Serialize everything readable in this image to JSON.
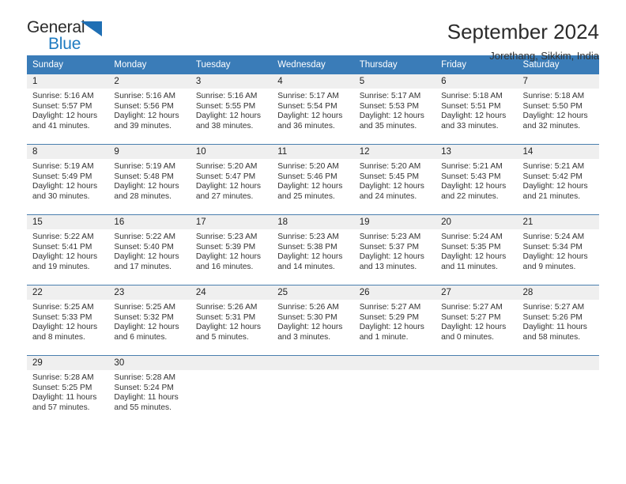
{
  "logo": {
    "word_one": "General",
    "word_two": "Blue",
    "triangle_icon": "triangle-icon",
    "accent_color": "#1f7bc1"
  },
  "header": {
    "title": "September 2024",
    "subtitle": "Jorethang, Sikkim, India"
  },
  "theme": {
    "header_blue": "#3a7cb8",
    "daynum_gray": "#efefef",
    "rule_color": "#4a7fae"
  },
  "weekdays": [
    "Sunday",
    "Monday",
    "Tuesday",
    "Wednesday",
    "Thursday",
    "Friday",
    "Saturday"
  ],
  "weeks": [
    [
      {
        "day": "1",
        "sunrise": "Sunrise: 5:16 AM",
        "sunset": "Sunset: 5:57 PM",
        "daylight_line1": "Daylight: 12 hours",
        "daylight_line2": "and 41 minutes."
      },
      {
        "day": "2",
        "sunrise": "Sunrise: 5:16 AM",
        "sunset": "Sunset: 5:56 PM",
        "daylight_line1": "Daylight: 12 hours",
        "daylight_line2": "and 39 minutes."
      },
      {
        "day": "3",
        "sunrise": "Sunrise: 5:16 AM",
        "sunset": "Sunset: 5:55 PM",
        "daylight_line1": "Daylight: 12 hours",
        "daylight_line2": "and 38 minutes."
      },
      {
        "day": "4",
        "sunrise": "Sunrise: 5:17 AM",
        "sunset": "Sunset: 5:54 PM",
        "daylight_line1": "Daylight: 12 hours",
        "daylight_line2": "and 36 minutes."
      },
      {
        "day": "5",
        "sunrise": "Sunrise: 5:17 AM",
        "sunset": "Sunset: 5:53 PM",
        "daylight_line1": "Daylight: 12 hours",
        "daylight_line2": "and 35 minutes."
      },
      {
        "day": "6",
        "sunrise": "Sunrise: 5:18 AM",
        "sunset": "Sunset: 5:51 PM",
        "daylight_line1": "Daylight: 12 hours",
        "daylight_line2": "and 33 minutes."
      },
      {
        "day": "7",
        "sunrise": "Sunrise: 5:18 AM",
        "sunset": "Sunset: 5:50 PM",
        "daylight_line1": "Daylight: 12 hours",
        "daylight_line2": "and 32 minutes."
      }
    ],
    [
      {
        "day": "8",
        "sunrise": "Sunrise: 5:19 AM",
        "sunset": "Sunset: 5:49 PM",
        "daylight_line1": "Daylight: 12 hours",
        "daylight_line2": "and 30 minutes."
      },
      {
        "day": "9",
        "sunrise": "Sunrise: 5:19 AM",
        "sunset": "Sunset: 5:48 PM",
        "daylight_line1": "Daylight: 12 hours",
        "daylight_line2": "and 28 minutes."
      },
      {
        "day": "10",
        "sunrise": "Sunrise: 5:20 AM",
        "sunset": "Sunset: 5:47 PM",
        "daylight_line1": "Daylight: 12 hours",
        "daylight_line2": "and 27 minutes."
      },
      {
        "day": "11",
        "sunrise": "Sunrise: 5:20 AM",
        "sunset": "Sunset: 5:46 PM",
        "daylight_line1": "Daylight: 12 hours",
        "daylight_line2": "and 25 minutes."
      },
      {
        "day": "12",
        "sunrise": "Sunrise: 5:20 AM",
        "sunset": "Sunset: 5:45 PM",
        "daylight_line1": "Daylight: 12 hours",
        "daylight_line2": "and 24 minutes."
      },
      {
        "day": "13",
        "sunrise": "Sunrise: 5:21 AM",
        "sunset": "Sunset: 5:43 PM",
        "daylight_line1": "Daylight: 12 hours",
        "daylight_line2": "and 22 minutes."
      },
      {
        "day": "14",
        "sunrise": "Sunrise: 5:21 AM",
        "sunset": "Sunset: 5:42 PM",
        "daylight_line1": "Daylight: 12 hours",
        "daylight_line2": "and 21 minutes."
      }
    ],
    [
      {
        "day": "15",
        "sunrise": "Sunrise: 5:22 AM",
        "sunset": "Sunset: 5:41 PM",
        "daylight_line1": "Daylight: 12 hours",
        "daylight_line2": "and 19 minutes."
      },
      {
        "day": "16",
        "sunrise": "Sunrise: 5:22 AM",
        "sunset": "Sunset: 5:40 PM",
        "daylight_line1": "Daylight: 12 hours",
        "daylight_line2": "and 17 minutes."
      },
      {
        "day": "17",
        "sunrise": "Sunrise: 5:23 AM",
        "sunset": "Sunset: 5:39 PM",
        "daylight_line1": "Daylight: 12 hours",
        "daylight_line2": "and 16 minutes."
      },
      {
        "day": "18",
        "sunrise": "Sunrise: 5:23 AM",
        "sunset": "Sunset: 5:38 PM",
        "daylight_line1": "Daylight: 12 hours",
        "daylight_line2": "and 14 minutes."
      },
      {
        "day": "19",
        "sunrise": "Sunrise: 5:23 AM",
        "sunset": "Sunset: 5:37 PM",
        "daylight_line1": "Daylight: 12 hours",
        "daylight_line2": "and 13 minutes."
      },
      {
        "day": "20",
        "sunrise": "Sunrise: 5:24 AM",
        "sunset": "Sunset: 5:35 PM",
        "daylight_line1": "Daylight: 12 hours",
        "daylight_line2": "and 11 minutes."
      },
      {
        "day": "21",
        "sunrise": "Sunrise: 5:24 AM",
        "sunset": "Sunset: 5:34 PM",
        "daylight_line1": "Daylight: 12 hours",
        "daylight_line2": "and 9 minutes."
      }
    ],
    [
      {
        "day": "22",
        "sunrise": "Sunrise: 5:25 AM",
        "sunset": "Sunset: 5:33 PM",
        "daylight_line1": "Daylight: 12 hours",
        "daylight_line2": "and 8 minutes."
      },
      {
        "day": "23",
        "sunrise": "Sunrise: 5:25 AM",
        "sunset": "Sunset: 5:32 PM",
        "daylight_line1": "Daylight: 12 hours",
        "daylight_line2": "and 6 minutes."
      },
      {
        "day": "24",
        "sunrise": "Sunrise: 5:26 AM",
        "sunset": "Sunset: 5:31 PM",
        "daylight_line1": "Daylight: 12 hours",
        "daylight_line2": "and 5 minutes."
      },
      {
        "day": "25",
        "sunrise": "Sunrise: 5:26 AM",
        "sunset": "Sunset: 5:30 PM",
        "daylight_line1": "Daylight: 12 hours",
        "daylight_line2": "and 3 minutes."
      },
      {
        "day": "26",
        "sunrise": "Sunrise: 5:27 AM",
        "sunset": "Sunset: 5:29 PM",
        "daylight_line1": "Daylight: 12 hours",
        "daylight_line2": "and 1 minute."
      },
      {
        "day": "27",
        "sunrise": "Sunrise: 5:27 AM",
        "sunset": "Sunset: 5:27 PM",
        "daylight_line1": "Daylight: 12 hours",
        "daylight_line2": "and 0 minutes."
      },
      {
        "day": "28",
        "sunrise": "Sunrise: 5:27 AM",
        "sunset": "Sunset: 5:26 PM",
        "daylight_line1": "Daylight: 11 hours",
        "daylight_line2": "and 58 minutes."
      }
    ],
    [
      {
        "day": "29",
        "sunrise": "Sunrise: 5:28 AM",
        "sunset": "Sunset: 5:25 PM",
        "daylight_line1": "Daylight: 11 hours",
        "daylight_line2": "and 57 minutes."
      },
      {
        "day": "30",
        "sunrise": "Sunrise: 5:28 AM",
        "sunset": "Sunset: 5:24 PM",
        "daylight_line1": "Daylight: 11 hours",
        "daylight_line2": "and 55 minutes."
      },
      {
        "day": "",
        "sunrise": "",
        "sunset": "",
        "daylight_line1": "",
        "daylight_line2": ""
      },
      {
        "day": "",
        "sunrise": "",
        "sunset": "",
        "daylight_line1": "",
        "daylight_line2": ""
      },
      {
        "day": "",
        "sunrise": "",
        "sunset": "",
        "daylight_line1": "",
        "daylight_line2": ""
      },
      {
        "day": "",
        "sunrise": "",
        "sunset": "",
        "daylight_line1": "",
        "daylight_line2": ""
      },
      {
        "day": "",
        "sunrise": "",
        "sunset": "",
        "daylight_line1": "",
        "daylight_line2": ""
      }
    ]
  ]
}
